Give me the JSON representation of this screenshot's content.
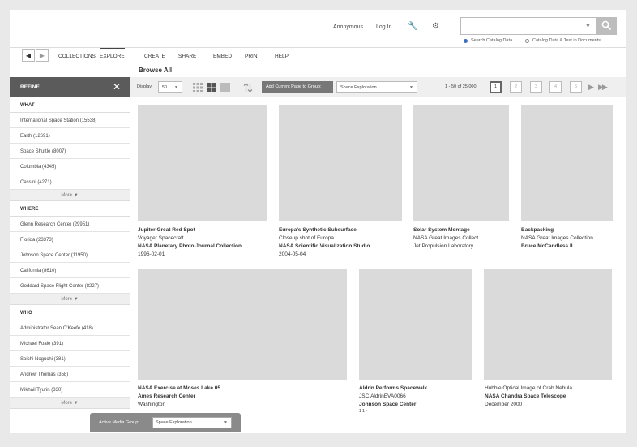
{
  "header": {
    "anonymous": "Anonymous",
    "login": "Log In",
    "wrench_icon": "wrench-icon",
    "gear_icon": "gear-icon",
    "search": {
      "value": "",
      "placeholder": "",
      "icon": "search-icon",
      "option_catalog": "Search Catalog Data",
      "option_catalog_text": "Catalog Data & Text in Documents"
    }
  },
  "nav": {
    "back_icon": "◀",
    "forward_icon": "▶",
    "tabs": [
      {
        "label": "COLLECTIONS"
      },
      {
        "label": "EXPLORE",
        "active": true
      },
      {
        "label": "CREATE"
      },
      {
        "label": "SHARE"
      },
      {
        "label": "EMBED"
      },
      {
        "label": "PRINT"
      },
      {
        "label": "HELP"
      }
    ]
  },
  "page_title": "Browse All",
  "refine": {
    "title": "REFINE",
    "close_icon": "✕",
    "more_label": "More",
    "sections": [
      {
        "label": "WHAT",
        "items": [
          "International Space Station (15538)",
          "Earth (12691)",
          "Space Shuttle (8007)",
          "Columbia (4345)",
          "Cassini (4271)"
        ]
      },
      {
        "label": "WHERE",
        "items": [
          "Glenn Research Center (29951)",
          "Florida (23373)",
          "Johnson Space Center (11950)",
          "California (8610)",
          "Goddard Space Flight Center (8227)"
        ]
      },
      {
        "label": "WHO",
        "items": [
          "Administrator Sean O'Keefe (418)",
          "Michael Foale (391)",
          "Soichi Noguchi (381)",
          "Andrew Thomas (358)",
          "Mikhail Tyurin (330)"
        ]
      }
    ]
  },
  "toolbar": {
    "display_label": "Display:",
    "display_value": "50",
    "add_button": "Add Current Page to Group:",
    "group_value": "Space Exploration",
    "range": "1 - 50 of 25,000",
    "pages": [
      "1",
      "2",
      "3",
      "4",
      "5"
    ],
    "next_icon": "▶",
    "last_icon": "▶▶"
  },
  "results": [
    {
      "title": "Jupiter Great Red Spot",
      "line2": "Voyager Spacecraft",
      "line3": "NASA Planetary Photo Journal Collection",
      "line4": "1996-02-01"
    },
    {
      "title": "Europa's Synthetic Subsurface",
      "line2": "Closeup shot of Europa",
      "line3": "NASA Scientific Visualization Studio",
      "line4": "2004-05-04"
    },
    {
      "title": "Solar System Montage",
      "line2": "NASA Great Images Collect...",
      "line3": "Jet Propulsion Laboratory",
      "line4": ""
    },
    {
      "title": "Backpacking",
      "line2": "NASA Great Images Collection",
      "line3": "Bruce McCandless II",
      "line4": ""
    },
    {
      "title": "NASA Exercise at Moses Lake 05",
      "line2": "Ames Research Center",
      "line3": "Washington",
      "line4": ""
    },
    {
      "title": "Aldrin Performs Spacewalk",
      "line2": "JSC.AldrinEVA0066",
      "line3": "Johnson Space Center",
      "line4": "1 1 ·"
    },
    {
      "title": "",
      "line2": "Hubble Optical Image of Crab Nebula",
      "line3": "NASA Chandra Space Telescope",
      "line4": "December 2000"
    }
  ],
  "active_media_group": {
    "label": "Active Media Group:",
    "value": "Space Exploration"
  }
}
